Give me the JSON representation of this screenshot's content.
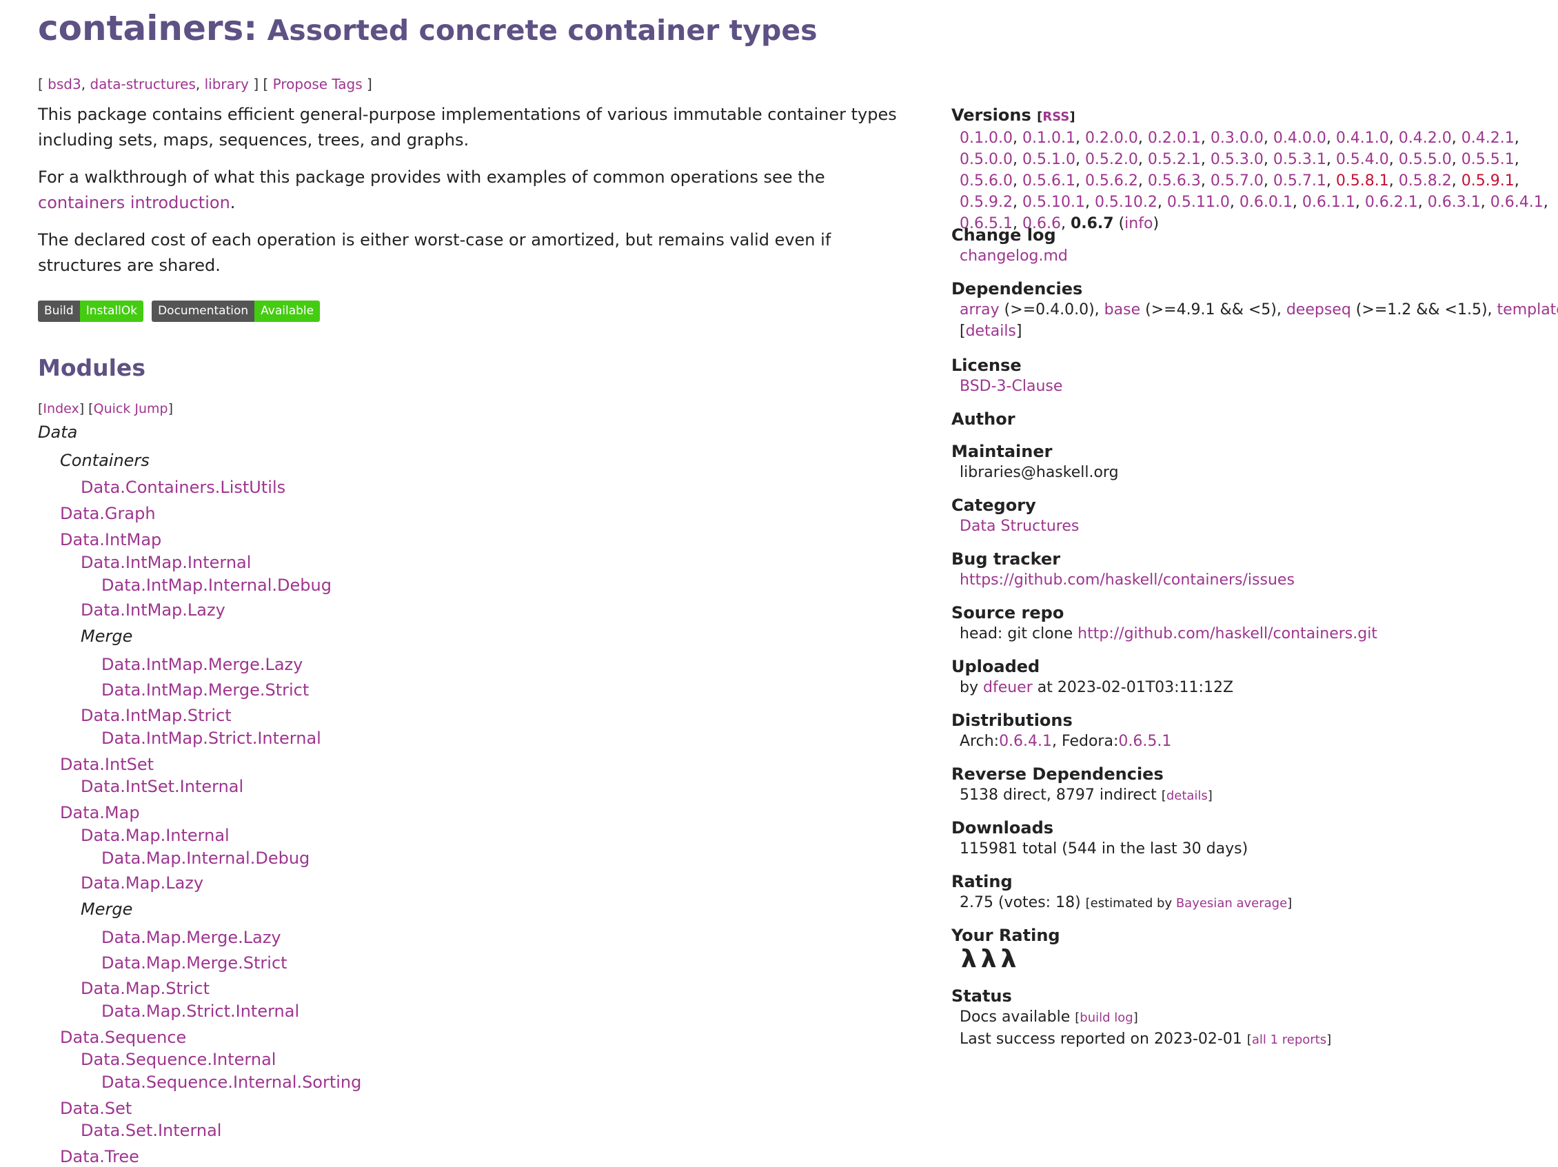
{
  "header": {
    "package": "containers",
    "colon": ":",
    "subtitle": " Assorted concrete container types"
  },
  "tags": {
    "open": "[ ",
    "items": [
      "bsd3",
      "data-structures",
      "library"
    ],
    "mid": " ] [ ",
    "propose": "Propose Tags",
    "close": " ]"
  },
  "description": {
    "p1": "This package contains efficient general-purpose implementations of various immutable container types including sets, maps, sequences, trees, and graphs.",
    "p2_pre": "For a walkthrough of what this package provides with examples of common operations see the ",
    "p2_link": "containers introduction",
    "p2_post": ".",
    "p3": "The declared cost of each operation is either worst-case or amortized, but remains valid even if structures are shared."
  },
  "badges": [
    {
      "left": "Build",
      "right": "InstallOk"
    },
    {
      "left": "Documentation",
      "right": "Available"
    }
  ],
  "modules": {
    "heading": "Modules",
    "index_link": "Index",
    "quickjump_link": "Quick Jump",
    "tree": [
      {
        "label": "Data",
        "kind": "cat",
        "level": 0
      },
      {
        "label": "Containers",
        "kind": "cat",
        "level": 1
      },
      {
        "label": "Data.Containers.ListUtils",
        "kind": "mod",
        "level": 2
      },
      {
        "label": "Data.Graph",
        "kind": "mod",
        "level": 1
      },
      {
        "label": "Data.IntMap",
        "kind": "mod",
        "level": 1
      },
      {
        "label": "Data.IntMap.Internal",
        "kind": "mod",
        "level": 2
      },
      {
        "label": "Data.IntMap.Internal.Debug",
        "kind": "mod",
        "level": 3
      },
      {
        "label": "Data.IntMap.Lazy",
        "kind": "mod",
        "level": 2
      },
      {
        "label": "Merge",
        "kind": "cat",
        "level": 2
      },
      {
        "label": "Data.IntMap.Merge.Lazy",
        "kind": "mod",
        "level": 3
      },
      {
        "label": "Data.IntMap.Merge.Strict",
        "kind": "mod",
        "level": 3
      },
      {
        "label": "Data.IntMap.Strict",
        "kind": "mod",
        "level": 2
      },
      {
        "label": "Data.IntMap.Strict.Internal",
        "kind": "mod",
        "level": 3
      },
      {
        "label": "Data.IntSet",
        "kind": "mod",
        "level": 1
      },
      {
        "label": "Data.IntSet.Internal",
        "kind": "mod",
        "level": 2
      },
      {
        "label": "Data.Map",
        "kind": "mod",
        "level": 1
      },
      {
        "label": "Data.Map.Internal",
        "kind": "mod",
        "level": 2
      },
      {
        "label": "Data.Map.Internal.Debug",
        "kind": "mod",
        "level": 3
      },
      {
        "label": "Data.Map.Lazy",
        "kind": "mod",
        "level": 2
      },
      {
        "label": "Merge",
        "kind": "cat",
        "level": 2
      },
      {
        "label": "Data.Map.Merge.Lazy",
        "kind": "mod",
        "level": 3
      },
      {
        "label": "Data.Map.Merge.Strict",
        "kind": "mod",
        "level": 3
      },
      {
        "label": "Data.Map.Strict",
        "kind": "mod",
        "level": 2
      },
      {
        "label": "Data.Map.Strict.Internal",
        "kind": "mod",
        "level": 3
      },
      {
        "label": "Data.Sequence",
        "kind": "mod",
        "level": 1
      },
      {
        "label": "Data.Sequence.Internal",
        "kind": "mod",
        "level": 2
      },
      {
        "label": "Data.Sequence.Internal.Sorting",
        "kind": "mod",
        "level": 3
      },
      {
        "label": "Data.Set",
        "kind": "mod",
        "level": 1
      },
      {
        "label": "Data.Set.Internal",
        "kind": "mod",
        "level": 2
      },
      {
        "label": "Data.Tree",
        "kind": "mod",
        "level": 1
      }
    ]
  },
  "sidebar": {
    "versions": {
      "label": "Versions",
      "rss": "RSS",
      "list": [
        {
          "v": "0.1.0.0",
          "style": "normal"
        },
        {
          "v": "0.1.0.1",
          "style": "normal"
        },
        {
          "v": "0.2.0.0",
          "style": "normal"
        },
        {
          "v": "0.2.0.1",
          "style": "normal"
        },
        {
          "v": "0.3.0.0",
          "style": "normal"
        },
        {
          "v": "0.4.0.0",
          "style": "normal"
        },
        {
          "v": "0.4.1.0",
          "style": "normal"
        },
        {
          "v": "0.4.2.0",
          "style": "normal"
        },
        {
          "v": "0.4.2.1",
          "style": "normal"
        },
        {
          "v": "0.5.0.0",
          "style": "normal"
        },
        {
          "v": "0.5.1.0",
          "style": "normal"
        },
        {
          "v": "0.5.2.0",
          "style": "normal"
        },
        {
          "v": "0.5.2.1",
          "style": "normal"
        },
        {
          "v": "0.5.3.0",
          "style": "normal"
        },
        {
          "v": "0.5.3.1",
          "style": "normal"
        },
        {
          "v": "0.5.4.0",
          "style": "normal"
        },
        {
          "v": "0.5.5.0",
          "style": "normal"
        },
        {
          "v": "0.5.5.1",
          "style": "normal"
        },
        {
          "v": "0.5.6.0",
          "style": "normal"
        },
        {
          "v": "0.5.6.1",
          "style": "normal"
        },
        {
          "v": "0.5.6.2",
          "style": "normal"
        },
        {
          "v": "0.5.6.3",
          "style": "normal"
        },
        {
          "v": "0.5.7.0",
          "style": "normal"
        },
        {
          "v": "0.5.7.1",
          "style": "normal"
        },
        {
          "v": "0.5.8.1",
          "style": "red"
        },
        {
          "v": "0.5.8.2",
          "style": "normal"
        },
        {
          "v": "0.5.9.1",
          "style": "red"
        },
        {
          "v": "0.5.9.2",
          "style": "normal"
        },
        {
          "v": "0.5.10.1",
          "style": "normal"
        },
        {
          "v": "0.5.10.2",
          "style": "normal"
        },
        {
          "v": "0.5.11.0",
          "style": "normal"
        },
        {
          "v": "0.6.0.1",
          "style": "normal"
        },
        {
          "v": "0.6.1.1",
          "style": "normal"
        },
        {
          "v": "0.6.2.1",
          "style": "normal"
        },
        {
          "v": "0.6.3.1",
          "style": "normal"
        },
        {
          "v": "0.6.4.1",
          "style": "normal"
        },
        {
          "v": "0.6.5.1",
          "style": "normal"
        },
        {
          "v": "0.6.6",
          "style": "normal"
        },
        {
          "v": "0.6.7",
          "style": "current"
        }
      ],
      "info": "info"
    },
    "changelog": {
      "label": "Change log",
      "link": "changelog.md"
    },
    "dependencies": {
      "label": "Dependencies",
      "items": [
        {
          "name": "array",
          "range": " (>=0.4.0.0), "
        },
        {
          "name": "base",
          "range": " (>=4.9.1 && <5), "
        },
        {
          "name": "deepseq",
          "range": " (>=1.2 && <1.5), "
        },
        {
          "name": "template-haskell",
          "range": ""
        }
      ],
      "details": "details"
    },
    "license": {
      "label": "License",
      "value": "BSD-3-Clause"
    },
    "author": {
      "label": "Author"
    },
    "maintainer": {
      "label": "Maintainer",
      "value": "libraries@haskell.org"
    },
    "category": {
      "label": "Category",
      "value": "Data Structures"
    },
    "bugtracker": {
      "label": "Bug tracker",
      "value": "https://github.com/haskell/containers/issues"
    },
    "sourcerepo": {
      "label": "Source repo",
      "prefix": "head: git clone ",
      "url": "http://github.com/haskell/containers.git"
    },
    "uploaded": {
      "label": "Uploaded",
      "by": "by ",
      "user": "dfeuer",
      "at": " at 2023-02-01T03:11:12Z"
    },
    "distributions": {
      "label": "Distributions",
      "arch": "Arch:",
      "arch_v": "0.6.4.1",
      "sep": ", Fedora:",
      "fedora_v": "0.6.5.1"
    },
    "revdeps": {
      "label": "Reverse Dependencies",
      "text": "5138 direct, 8797 indirect ",
      "details": "details"
    },
    "downloads": {
      "label": "Downloads",
      "text": "115981 total (544 in the last 30 days)"
    },
    "rating": {
      "label": "Rating",
      "text": "2.75 (votes: 18) ",
      "est": "estimated by ",
      "bayes": "Bayesian average"
    },
    "yourrating": {
      "label": "Your Rating",
      "lambdas": "λλλ"
    },
    "status": {
      "label": "Status",
      "docs": "Docs available ",
      "buildlog": "build log",
      "last": "Last success reported on 2023-02-01 ",
      "reports": "all 1 reports"
    }
  }
}
